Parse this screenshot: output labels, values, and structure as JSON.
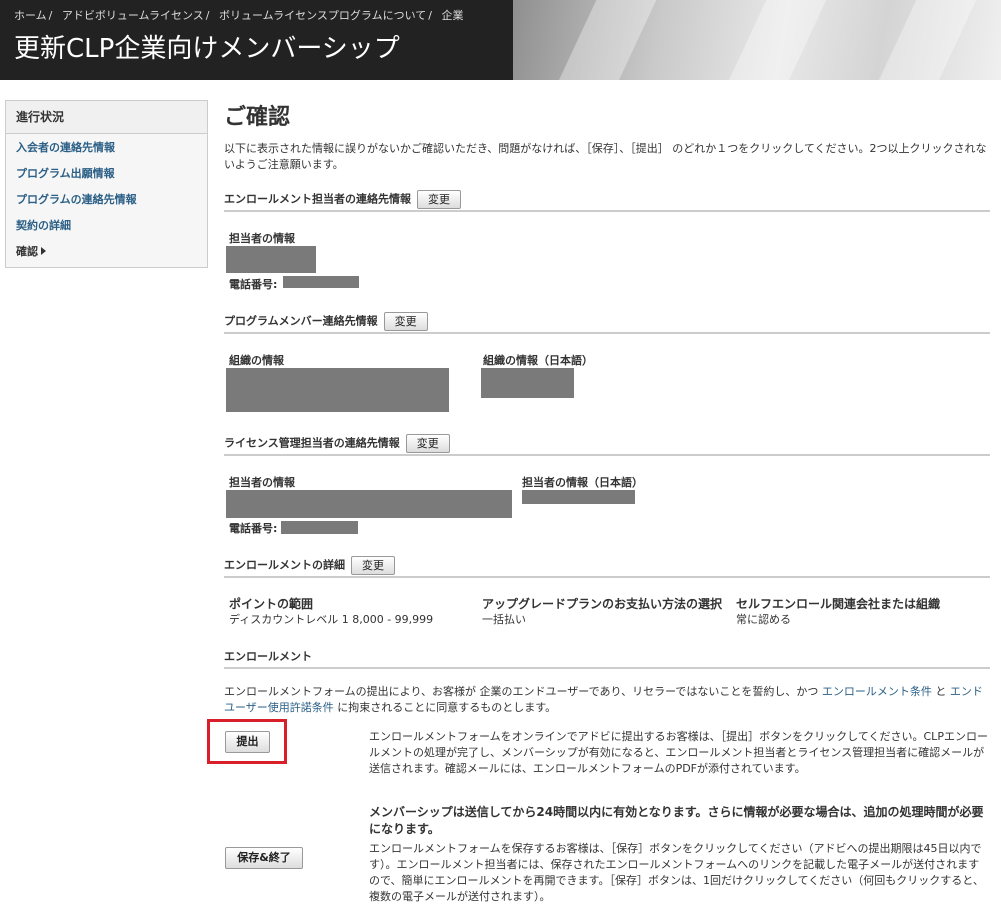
{
  "breadcrumb": [
    {
      "label": "ホーム"
    },
    {
      "label": "アドビボリュームライセンス"
    },
    {
      "label": "ボリュームライセンスプログラムについて"
    },
    {
      "label": "企業"
    }
  ],
  "breadcrumb_sep": "/",
  "page_title": "更新CLP企業向けメンバーシップ",
  "sidebar": {
    "heading": "進行状況",
    "items": [
      {
        "label": "入会者の連絡先情報"
      },
      {
        "label": "プログラム出願情報"
      },
      {
        "label": "プログラムの連絡先情報"
      },
      {
        "label": "契約の詳細"
      },
      {
        "label": "確認"
      }
    ]
  },
  "main": {
    "title": "ご確認",
    "intro": "以下に表示された情報に誤りがないかご確認いただき、問題がなければ、［保存］、［提出］ のどれか１つをクリックしてください。2つ以上クリックされないようご注意願います。",
    "change_label": "変更",
    "sections": {
      "enrollment_contact": {
        "heading": "エンロールメント担当者の連絡先情報",
        "contact_label": "担当者の情報",
        "phone_label": "電話番号:"
      },
      "program_member": {
        "heading": "プログラムメンバー連絡先情報",
        "org_label": "組織の情報",
        "org_label_ja": "組織の情報（日本語）"
      },
      "license_admin": {
        "heading": "ライセンス管理担当者の連絡先情報",
        "contact_label": "担当者の情報",
        "contact_label_ja": "担当者の情報（日本語）",
        "phone_label": "電話番号:"
      },
      "enrollment_details": {
        "heading": "エンロールメントの詳細",
        "points_label": "ポイントの範囲",
        "points_value": "ディスカウントレベル 1  8,000 -  99,999",
        "payment_label": "アップグレードプランのお支払い方法の選択",
        "payment_value": "一括払い",
        "affiliate_label": "セルフエンロール関連会社または組織",
        "affiliate_value": "常に認める"
      },
      "enrollment": {
        "heading": "エンロールメント"
      }
    },
    "terms": {
      "text_1": "エンロールメントフォームの提出により、お客様が 企業のエンドユーザーであり、リセラーではないことを誓約し、かつ ",
      "link_1": "エンロールメント条件",
      "text_2": " と ",
      "link_2": "エンドユーザー使用許諾条件",
      "text_3": " に拘束されることに同意するものとします。"
    },
    "submit_button": "提出",
    "submit_text": "エンロールメントフォームをオンラインでアドビに提出するお客様は、［提出］ボタンをクリックしてください。CLPエンロールメントの処理が完了し、メンバーシップが有効になると、エンロールメント担当者とライセンス管理担当者に確認メールが送信されます。確認メールには、エンロールメントフォームのPDFが添付されています。",
    "activation_note": "メンバーシップは送信してから24時間以内に有効となります。さらに情報が必要な場合は、追加の処理時間が必要になります。",
    "save_button": "保存&終了",
    "save_text": "エンロールメントフォームを保存するお客様は、［保存］ボタンをクリックしてください（アドビへの提出期限は45日以内です）。エンロールメント担当者には、保存されたエンロールメントフォームへのリンクを記載した電子メールが送付されますので、簡単にエンロールメントを再開できます。［保存］ボタンは、1回だけクリックしてください（何回もクリックすると、複数の電子メールが送付されます）。"
  },
  "colors": {
    "header_bg": "#222222",
    "link": "#2b5f86",
    "highlight": "#d9202a",
    "redaction": "#7a7a7a"
  }
}
